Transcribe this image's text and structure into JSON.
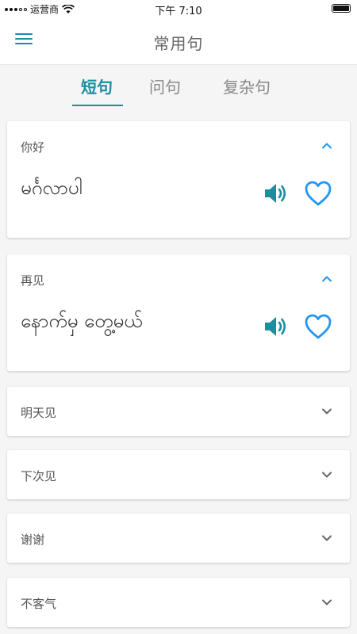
{
  "status_bar": {
    "carrier": "运营商",
    "time": "下午 7:10"
  },
  "header": {
    "title": "常用句",
    "menu_icon": "hamburger-menu-icon"
  },
  "tabs": [
    {
      "label": "短句",
      "active": true
    },
    {
      "label": "问句",
      "active": false
    },
    {
      "label": "复杂句",
      "active": false
    }
  ],
  "phrases": [
    {
      "chinese": "你好",
      "burmese": "မင်္ဂလာပါ",
      "expanded": true
    },
    {
      "chinese": "再见",
      "burmese": "နောက်မှ တွေ့မယ်",
      "expanded": true
    },
    {
      "chinese": "明天见",
      "expanded": false
    },
    {
      "chinese": "下次见",
      "expanded": false
    },
    {
      "chinese": "谢谢",
      "expanded": false
    },
    {
      "chinese": "不客气",
      "expanded": false
    }
  ],
  "colors": {
    "accent": "#1b8fa0",
    "heart": "#2196f3",
    "chevron_expanded": "#2196f3",
    "chevron_collapsed": "#666666"
  }
}
